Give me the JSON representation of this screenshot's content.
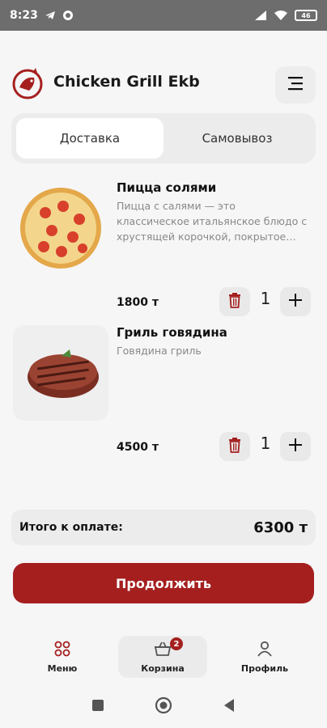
{
  "status_bar": {
    "time": "8:23",
    "battery": "46",
    "icons": [
      "telegram-icon",
      "whatsapp-icon",
      "signal-icon",
      "wifi-icon",
      "battery-icon"
    ]
  },
  "header": {
    "brand": "Chicken Grill Ekb",
    "logo": "chicken-logo",
    "menu_icon": "hamburger-icon"
  },
  "tabs": [
    {
      "label": "Доставка",
      "active": true
    },
    {
      "label": "Самовывоз",
      "active": false
    }
  ],
  "cart_items": [
    {
      "name": "Пицца солями",
      "description": "Пицца с салями — это классическое итальянское блюдо с хрустящей корочкой, покрытое…",
      "price": "1800 т",
      "quantity": "1",
      "image": "pizza-image"
    },
    {
      "name": "Гриль говядина",
      "description": "Говядина гриль",
      "price": "4500 т",
      "quantity": "1",
      "image": "steak-image"
    }
  ],
  "summary": {
    "label": "Итого к оплате:",
    "value": "6300 т"
  },
  "continue_label": "Продолжить",
  "bottom_nav": [
    {
      "label": "Меню",
      "icon": "menu-grid-icon",
      "active": false
    },
    {
      "label": "Корзина",
      "icon": "basket-icon",
      "active": true,
      "badge": "2"
    },
    {
      "label": "Профиль",
      "icon": "profile-icon",
      "active": false
    }
  ],
  "colors": {
    "accent": "#a51f1f",
    "background": "#f6f6f6",
    "surface": "#ececec"
  }
}
